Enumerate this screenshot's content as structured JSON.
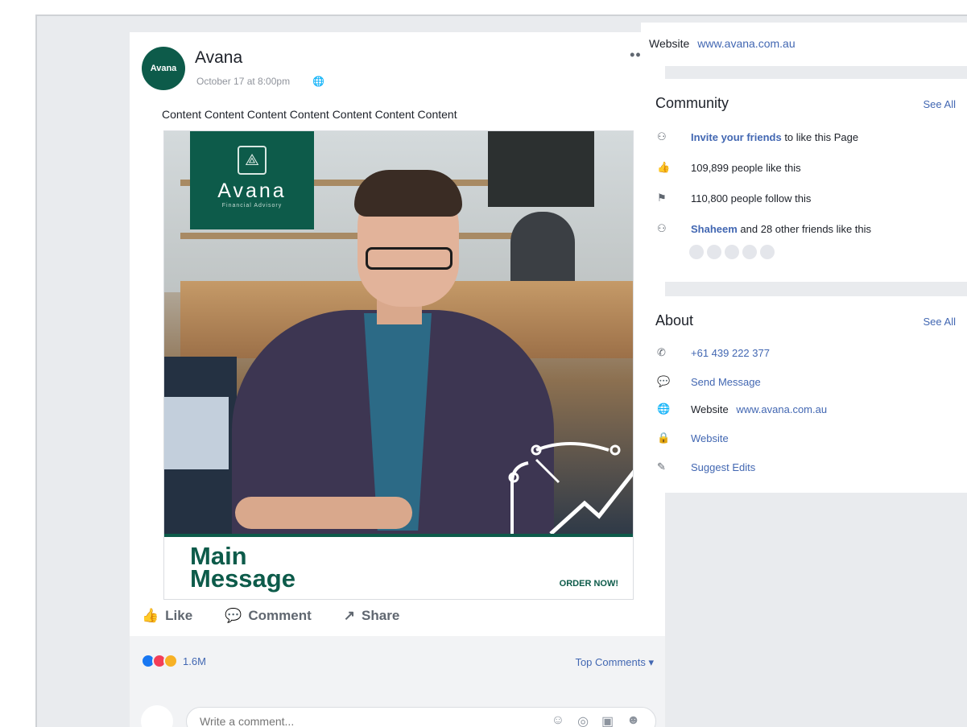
{
  "post": {
    "page_name": "Avana",
    "timestamp": "October 17 at 8:00pm",
    "audience_icon": "globe-icon",
    "more_label": "•••",
    "text": "Content Content Content Content Content Content Content",
    "ad": {
      "brand_name": "Avana",
      "brand_tagline": "Financial Advisory",
      "brand_mark": "⟁",
      "main_message": "Main Message",
      "cta": "ORDER NOW!"
    },
    "actions": {
      "like": "Like",
      "comment": "Comment",
      "share": "Share"
    },
    "reactions": {
      "count": "1.6M",
      "top_comments": "Top Comments ▾"
    },
    "comment_placeholder": "Write a comment..."
  },
  "sidebar": {
    "website_card": {
      "label": "Website",
      "url": "www.avana.com.au"
    },
    "community": {
      "title": "Community",
      "see_all": "See All",
      "invite_link": "Invite your friends",
      "invite_rest": " to like this Page",
      "likes": "109,899 people like this",
      "follows": "110,800 people follow this",
      "friend_name": "Shaheem",
      "friends_rest": " and 28 other friends like this"
    },
    "about": {
      "title": "About",
      "see_all": "See All",
      "phone": "+61 439 222 377",
      "send_message": "Send Message",
      "website_label": "Website",
      "website_url": "www.avana.com.au",
      "website_link": "Website",
      "suggest_edits": "Suggest Edits"
    }
  },
  "colors": {
    "brand_green": "#0d5b4a",
    "link_blue": "#4267b2",
    "page_bg": "#e9ebee"
  }
}
